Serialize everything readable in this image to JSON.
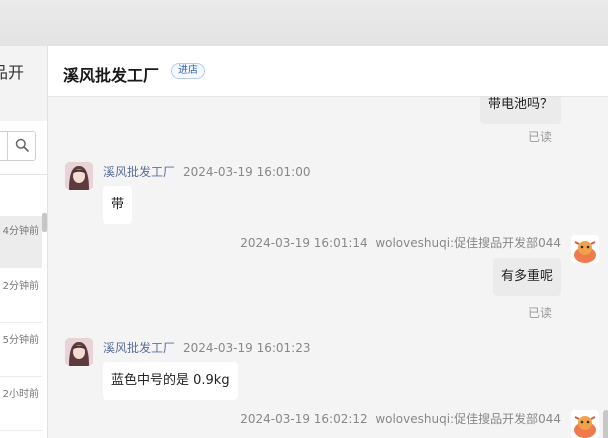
{
  "left_panel": {
    "header_text": "品开",
    "conversations": [
      {
        "time": "4分钟前"
      },
      {
        "time": "2分钟前"
      },
      {
        "time": "5分钟前"
      },
      {
        "time": "2小时前"
      }
    ]
  },
  "chat_header": {
    "shop_name": "溪风批发工厂",
    "badge": "进店"
  },
  "messages": [
    {
      "text": "带电池吗？",
      "read": "已读"
    },
    {
      "sender": "溪风批发工厂",
      "time": "2024-03-19 16:01:00",
      "text": "带"
    },
    {
      "sender": "woloveshuqi:促佳搜品开发部044",
      "time": "2024-03-19 16:01:14",
      "text": "有多重呢",
      "read": "已读"
    },
    {
      "sender": "溪风批发工厂",
      "time": "2024-03-19 16:01:23",
      "text": "蓝色中号的是 0.9kg"
    },
    {
      "sender": "woloveshuqi:促佳搜品开发部044",
      "time": "2024-03-19 16:02:12"
    }
  ]
}
